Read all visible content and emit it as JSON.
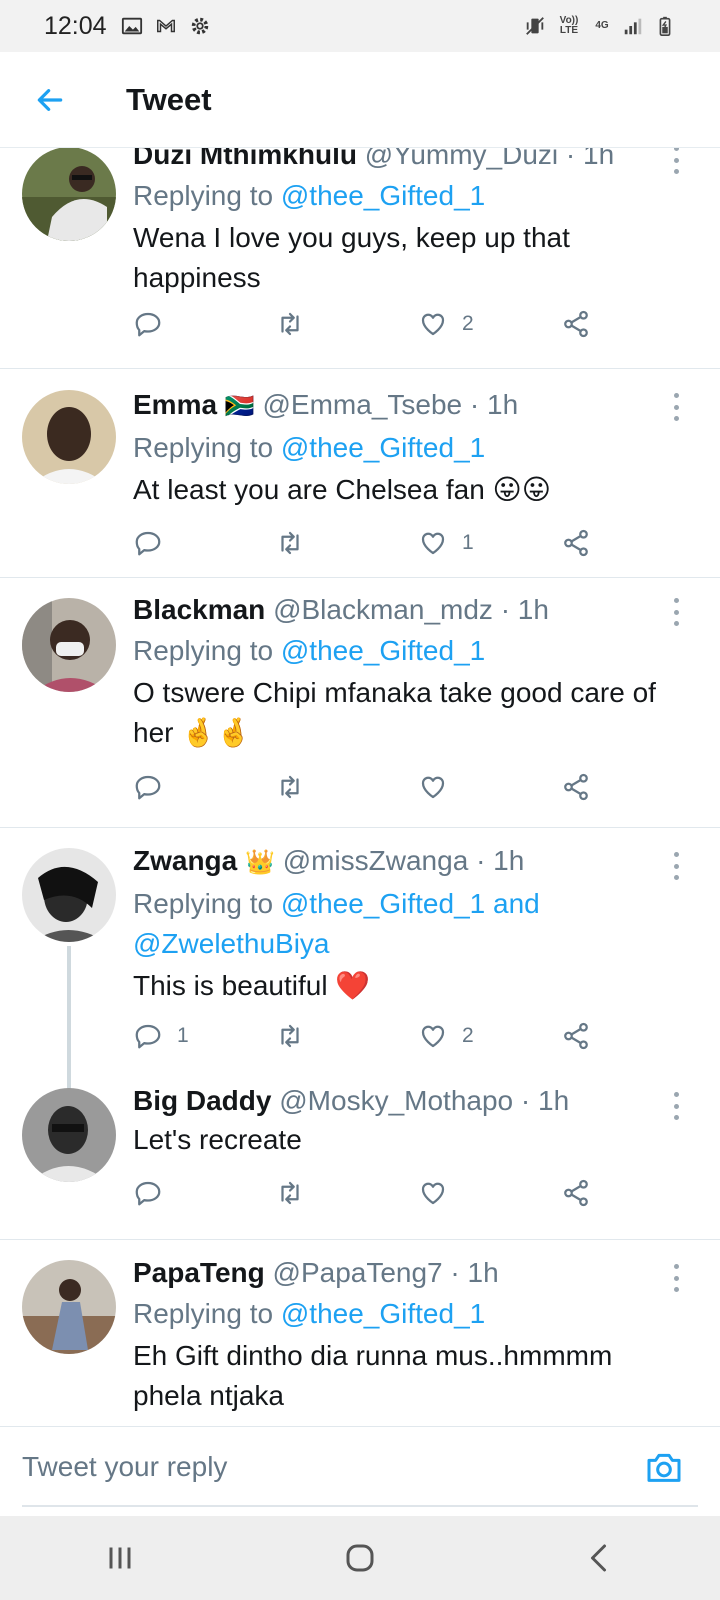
{
  "status_bar": {
    "time": "12:04",
    "volte": "Vo)) LTE",
    "network": "4G"
  },
  "header": {
    "title": "Tweet"
  },
  "tweets": [
    {
      "name": "Duzi Mthimkhulu",
      "emoji": "",
      "handle": "@Yummy_Duzi",
      "time": "· 1h",
      "reply_prefix": "Replying to ",
      "reply_to": "@thee_Gifted_1",
      "reply_to_2": "",
      "text": "Wena I love you guys, keep up that happiness",
      "reply_count": "",
      "retweet_count": "",
      "like_count": "2"
    },
    {
      "name": "Emma",
      "emoji": "🇿🇦",
      "handle": "@Emma_Tsebe",
      "time": "· 1h",
      "reply_prefix": "Replying to ",
      "reply_to": "@thee_Gifted_1",
      "reply_to_2": "",
      "text": "At least you are Chelsea fan 😛😛",
      "reply_count": "",
      "retweet_count": "",
      "like_count": "1"
    },
    {
      "name": "Blackman",
      "emoji": "",
      "handle": "@Blackman_mdz",
      "time": "· 1h",
      "reply_prefix": "Replying to ",
      "reply_to": "@thee_Gifted_1",
      "reply_to_2": "",
      "text": "O tswere Chipi mfanaka take good care of her 🤞🤞",
      "reply_count": "",
      "retweet_count": "",
      "like_count": ""
    },
    {
      "name": "Zwanga",
      "emoji": "👑",
      "handle": "@missZwanga",
      "time": "· 1h",
      "reply_prefix": "Replying to ",
      "reply_to": "@thee_Gifted_1 and",
      "reply_to_2": "@ZwelethuBiya",
      "text": "This is beautiful ❤️",
      "reply_count": "1",
      "retweet_count": "",
      "like_count": "2"
    },
    {
      "name": "Big Daddy",
      "emoji": "",
      "handle": "@Mosky_Mothapo",
      "time": "· 1h",
      "reply_prefix": "",
      "reply_to": "",
      "reply_to_2": "",
      "text": "Let's recreate",
      "reply_count": "",
      "retweet_count": "",
      "like_count": ""
    },
    {
      "name": "PapaTeng",
      "emoji": "",
      "handle": "@PapaTeng7",
      "time": "· 1h",
      "reply_prefix": "Replying to ",
      "reply_to": "@thee_Gifted_1",
      "reply_to_2": "",
      "text": "Eh Gift dintho dia runna mus..hmmmm phela ntjaka",
      "reply_count": "",
      "retweet_count": "",
      "like_count": ""
    }
  ],
  "compose": {
    "placeholder": "Tweet your reply"
  },
  "icons": [
    "back-arrow-icon",
    "more-options-icon",
    "reply-icon",
    "retweet-icon",
    "like-icon",
    "share-icon",
    "camera-icon",
    "recents-icon",
    "home-icon",
    "back-icon"
  ],
  "colors": {
    "accent": "#1da1f2",
    "secondary_text": "#657786",
    "primary_text": "#14171a"
  }
}
